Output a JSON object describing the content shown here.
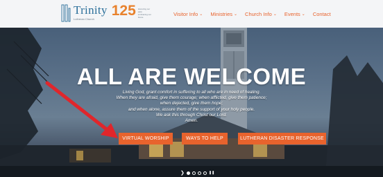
{
  "header": {
    "logo": {
      "name": "Trinity",
      "subtitle": "Lutheran Church",
      "anniversary_number": "125",
      "tagline": "Honoring our past, embracing our future"
    },
    "nav": [
      {
        "label": "Visitor Info",
        "has_dropdown": true
      },
      {
        "label": "Ministries",
        "has_dropdown": true
      },
      {
        "label": "Church Info",
        "has_dropdown": true
      },
      {
        "label": "Events",
        "has_dropdown": true
      },
      {
        "label": "Contact",
        "has_dropdown": false
      }
    ]
  },
  "hero": {
    "headline": "ALL ARE WELCOME",
    "prayer_lines": [
      "Living God, grant comfort in suffering to all who are in need of healing.",
      "When they are afraid, give them courage; when afflicted, give them patience;",
      "when dejected, give them hope;",
      "and when alone, assure them of the support of your holy people.",
      "We ask this through Christ our Lord.",
      "Amen."
    ],
    "buttons": [
      {
        "label": "VIRTUAL WORSHIP"
      },
      {
        "label": "WAYS TO HELP"
      },
      {
        "label": "LUTHERAN DISASTER RESPONSE"
      }
    ],
    "slider": {
      "prev_symbol": "❯",
      "slide_count": 4,
      "active_index": 0,
      "pause_symbol": "❚❚"
    }
  },
  "colors": {
    "accent": "#e8632d",
    "brand_blue": "#2b6f9a",
    "header_bg": "#f4f5f7",
    "annotation_arrow": "#e0262b"
  },
  "icons": {
    "dropdown": "chevron-down-icon",
    "logo": "cross-logo-icon"
  }
}
